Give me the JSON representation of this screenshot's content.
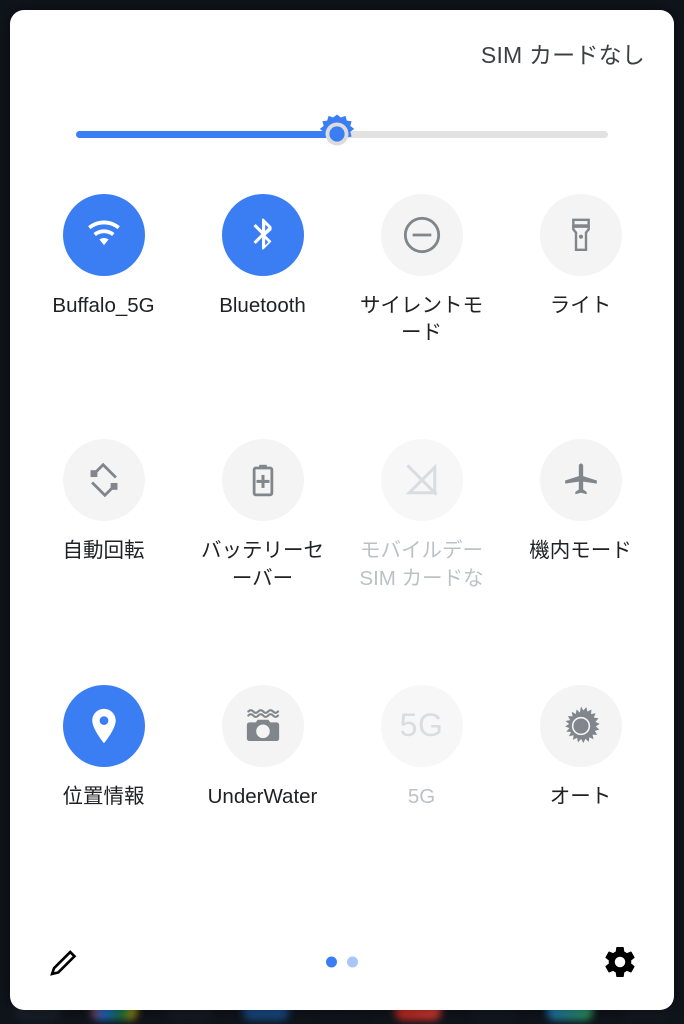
{
  "status": {
    "carrier_text": "SIM カードなし"
  },
  "brightness": {
    "name": "brightness-slider",
    "value_percent": 49,
    "thumb_icon": "sun-brightness-icon",
    "fill_color": "#3b7ef4",
    "track_color": "#e2e2e2"
  },
  "colors": {
    "accent_blue": "#3b7ef4",
    "tile_inactive_bg": "#f4f4f4",
    "icon_inactive": "#80868b",
    "label_text": "#202124",
    "label_disabled": "#bdc1c6",
    "panel_bg": "#ffffff",
    "screen_bg": "#000000"
  },
  "tiles": [
    {
      "name": "tile-wifi",
      "label": "Buffalo_5G",
      "icon": "wifi-icon",
      "state": "on"
    },
    {
      "name": "tile-bluetooth",
      "label": "Bluetooth",
      "icon": "bluetooth-icon",
      "state": "on"
    },
    {
      "name": "tile-silent-mode",
      "label": "サイレントモード",
      "icon": "do-not-disturb-icon",
      "state": "off"
    },
    {
      "name": "tile-flashlight",
      "label": "ライト",
      "icon": "flashlight-icon",
      "state": "off"
    },
    {
      "name": "tile-auto-rotate",
      "label": "自動回転",
      "icon": "auto-rotate-icon",
      "state": "off"
    },
    {
      "name": "tile-battery-saver",
      "label": "バッテリーセーバー",
      "icon": "battery-plus-icon",
      "state": "off"
    },
    {
      "name": "tile-mobile-data",
      "label": "モバイルデー SIM カードな",
      "icon": "mobile-data-off-icon",
      "state": "disabled"
    },
    {
      "name": "tile-airplane-mode",
      "label": "機内モード",
      "icon": "airplane-icon",
      "state": "off"
    },
    {
      "name": "tile-location",
      "label": "位置情報",
      "icon": "location-pin-icon",
      "state": "on"
    },
    {
      "name": "tile-underwater",
      "label": "UnderWater",
      "icon": "underwater-camera-icon",
      "state": "off"
    },
    {
      "name": "tile-5g",
      "label": "5G",
      "icon": "5g-text-icon",
      "state": "disabled"
    },
    {
      "name": "tile-auto-brightness",
      "label": "オート",
      "icon": "sun-icon",
      "state": "off"
    }
  ],
  "footer": {
    "edit_icon": "pencil-edit-icon",
    "settings_icon": "gear-settings-icon",
    "pages": {
      "count": 2,
      "current": 1
    }
  }
}
